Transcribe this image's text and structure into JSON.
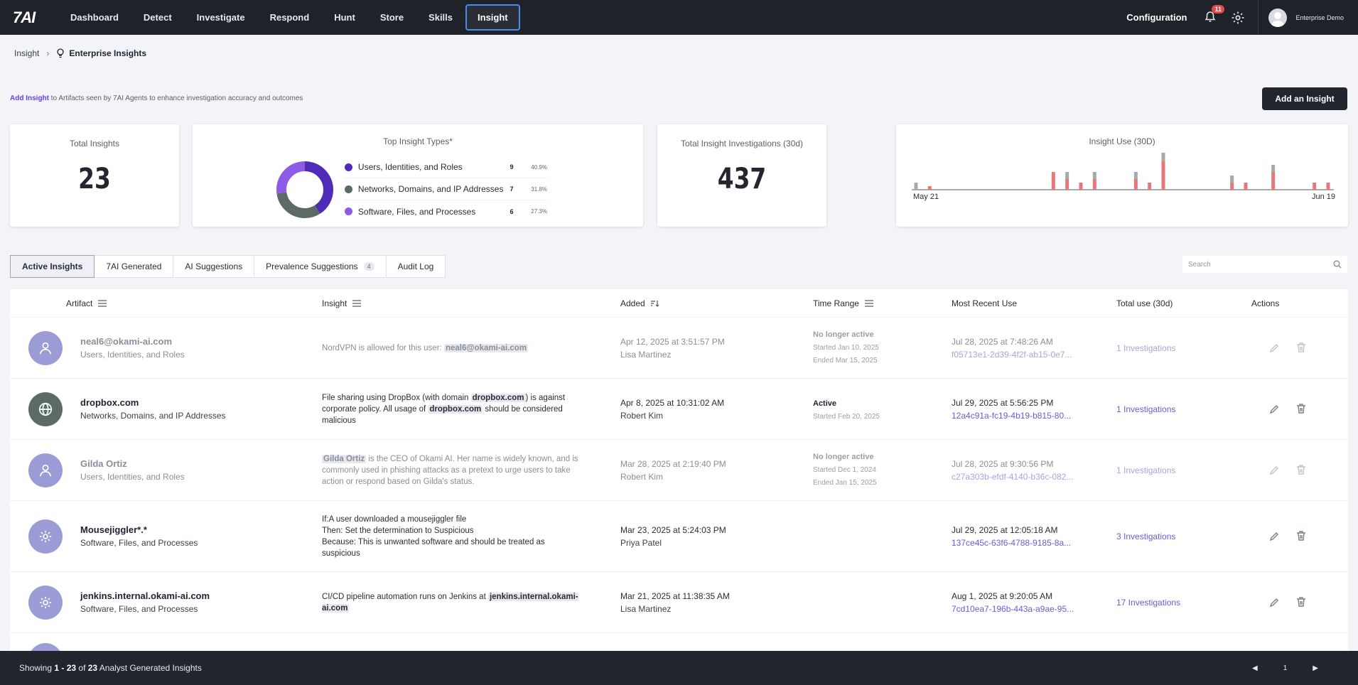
{
  "nav": {
    "logo": "7AI",
    "items": [
      "Dashboard",
      "Detect",
      "Investigate",
      "Respond",
      "Hunt",
      "Store",
      "Skills",
      "Insight"
    ],
    "active_index": 7,
    "configuration": "Configuration",
    "notification_count": "11",
    "user": "Enterprise Demo"
  },
  "breadcrumb": {
    "parent": "Insight",
    "current": "Enterprise Insights"
  },
  "intro": {
    "link": "Add Insight",
    "text": " to Artifacts seen by 7AI Agents to enhance investigation accuracy and outcomes"
  },
  "add_button": "Add an Insight",
  "stats": {
    "total_insights": {
      "title": "Total Insights",
      "value": "23"
    },
    "top_types": {
      "title": "Top Insight Types*",
      "items": [
        {
          "label": "Users, Identities, and Roles",
          "count": "9",
          "pct": "40.9%",
          "color": "#4f2bb8",
          "fraction": 0.409
        },
        {
          "label": "Networks, Domains, and IP Addresses",
          "count": "7",
          "pct": "31.8%",
          "color": "#5d6b68",
          "fraction": 0.318
        },
        {
          "label": "Software, Files, and Processes",
          "count": "6",
          "pct": "27.3%",
          "color": "#8e5be6",
          "fraction": 0.273
        }
      ]
    },
    "total_investigations": {
      "title": "Total Insight Investigations (30d)",
      "value": "437"
    },
    "insight_use": {
      "title": "Insight Use (30D)",
      "start_label": "May 21",
      "end_label": "Jun 19"
    }
  },
  "chart_data": {
    "type": "bar",
    "title": "Insight Use (30D)",
    "x_start": "May 21",
    "x_end": "Jun 19",
    "series": [
      {
        "color": "#e8777b",
        "values": [
          0,
          1,
          0,
          0,
          0,
          0,
          0,
          0,
          0,
          0,
          5,
          3,
          2,
          3,
          0,
          0,
          3,
          2,
          8,
          0,
          0,
          0,
          0,
          2,
          2,
          0,
          5,
          0,
          0,
          2,
          2
        ]
      },
      {
        "color": "#a4aca8",
        "values": [
          2,
          0,
          0,
          0,
          0,
          0,
          0,
          0,
          0,
          0,
          0,
          2,
          0,
          2,
          0,
          0,
          2,
          0,
          3,
          0,
          0,
          0,
          0,
          2,
          0,
          0,
          2,
          0,
          0,
          0,
          0
        ]
      }
    ]
  },
  "tabs": [
    {
      "label": "Active Insights",
      "count": ""
    },
    {
      "label": "7AI Generated",
      "count": ""
    },
    {
      "label": "AI Suggestions",
      "count": ""
    },
    {
      "label": "Prevalence Suggestions",
      "count": "4"
    },
    {
      "label": "Audit Log",
      "count": ""
    }
  ],
  "search": {
    "placeholder": "Search"
  },
  "table": {
    "headers": [
      "Artifact",
      "Insight",
      "Added",
      "Time Range",
      "Most Recent Use",
      "Total use (30d)",
      "Actions"
    ],
    "rows": [
      {
        "name": "neal6@okami-ai.com",
        "type": "Users, Identities, and Roles",
        "icon": "user-icon",
        "avatar_color": "#9b9cd6",
        "insight_parts": [
          {
            "t": "NordVPN is allowed for this user: "
          },
          {
            "t": "neal6@okami-ai.com",
            "hl": true
          }
        ],
        "added": "Apr 12, 2025 at 3:51:57 PM",
        "added_by": "Lisa Martinez",
        "status": "No longer active",
        "started": "Started Jan 10, 2025",
        "ended": "Ended Mar 15, 2025",
        "mru_date": "Jul 28, 2025 at 7:48:26 AM",
        "mru_id": "f05713e1-2d39-4f2f-ab15-0e7...",
        "total": "1 Investigations",
        "muted": true
      },
      {
        "name": "dropbox.com",
        "type": "Networks, Domains, and IP Addresses",
        "icon": "globe-icon",
        "avatar_color": "#5d6b68",
        "insight_parts": [
          {
            "t": "File sharing using DropBox (with domain "
          },
          {
            "t": "dropbox.com",
            "hl": true
          },
          {
            "t": ") is against corporate policy. All usage of "
          },
          {
            "t": "dropbox.com",
            "hl": true
          },
          {
            "t": " should be considered malicious"
          }
        ],
        "added": "Apr 8, 2025 at 10:31:02 AM",
        "added_by": "Robert Kim",
        "status": "Active",
        "started": "Started Feb 20, 2025",
        "ended": "",
        "mru_date": "Jul 29, 2025 at 5:56:25 PM",
        "mru_id": "12a4c91a-fc19-4b19-b815-80...",
        "total": "1 Investigations",
        "muted": false
      },
      {
        "name": "Gilda Ortiz",
        "type": "Users, Identities, and Roles",
        "icon": "user-icon",
        "avatar_color": "#9b9cd6",
        "insight_parts": [
          {
            "t": "Gilda Ortiz",
            "hl": true
          },
          {
            "t": " is the CEO of Okami AI. Her name is widely known, and is commonly used in phishing attacks as a pretext to urge users to take action or respond based on Gilda's status."
          }
        ],
        "added": "Mar 28, 2025 at 2:19:40 PM",
        "added_by": "Robert Kim",
        "status": "No longer active",
        "started": "Started Dec 1, 2024",
        "ended": "Ended Jan 15, 2025",
        "mru_date": "Jul 28, 2025 at 9:30:56 PM",
        "mru_id": "c27a303b-efdf-4140-b36c-082...",
        "total": "1 Investigations",
        "muted": true
      },
      {
        "name": "Mousejiggler*.*",
        "type": "Software, Files, and Processes",
        "icon": "gear-icon",
        "avatar_color": "#9b9cd6",
        "insight_parts": [
          {
            "t": "If:A user downloaded a mousejiggler file\nThen: Set the determination to Suspicious\nBecause: This is unwanted software and should be treated as suspicious"
          }
        ],
        "added": "Mar 23, 2025 at 5:24:03 PM",
        "added_by": "Priya Patel",
        "status": "",
        "started": "",
        "ended": "",
        "mru_date": "Jul 29, 2025 at 12:05:18 AM",
        "mru_id": "137ce45c-63f6-4788-9185-8a...",
        "total": "3 Investigations",
        "muted": false
      },
      {
        "name": "jenkins.internal.okami-ai.com",
        "type": "Software, Files, and Processes",
        "icon": "gear-icon",
        "avatar_color": "#9b9cd6",
        "insight_parts": [
          {
            "t": "CI/CD pipeline automation runs on Jenkins at "
          },
          {
            "t": "jenkins.internal.okami-ai.com",
            "hl": true
          }
        ],
        "added": "Mar 21, 2025 at 11:38:35 AM",
        "added_by": "Lisa Martinez",
        "status": "",
        "started": "",
        "ended": "",
        "mru_date": "Aug 1, 2025 at 9:20:05 AM",
        "mru_id": "7cd10ea7-196b-443a-a9ae-95...",
        "total": "17 Investigations",
        "muted": false
      }
    ]
  },
  "footer": {
    "prefix": "Showing ",
    "range": "1 - 23",
    "of": " of ",
    "total": "23",
    "suffix": " Analyst Generated Insights",
    "page": "1"
  }
}
